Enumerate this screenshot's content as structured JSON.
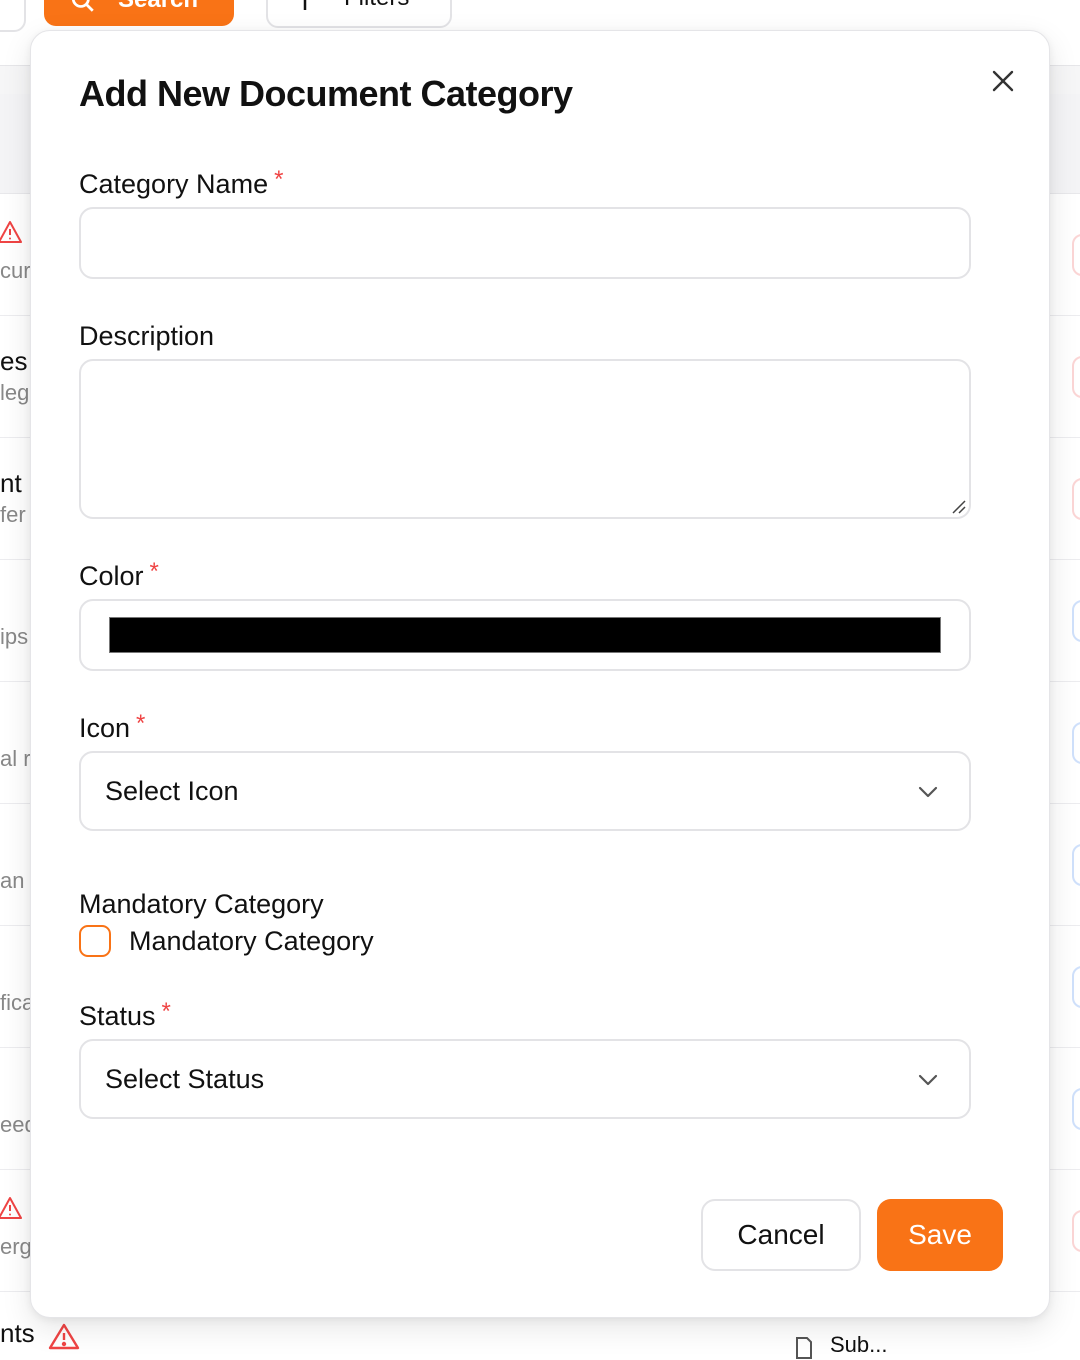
{
  "background": {
    "search_button_label": "Search",
    "filters_button_label": "Filters",
    "rows": [
      {
        "t1": "",
        "t2": "cur",
        "warn": true,
        "pill": "red"
      },
      {
        "t1": "es",
        "t2": "leg",
        "warn": false,
        "pill": "red"
      },
      {
        "t1": "nt",
        "t2": "fer",
        "warn": false,
        "pill": "red"
      },
      {
        "t1": "",
        "t2": "ips",
        "warn": false,
        "pill": "blue"
      },
      {
        "t1": "",
        "t2": "al r",
        "warn": false,
        "pill": "blue"
      },
      {
        "t1": "",
        "t2": "an",
        "warn": false,
        "pill": "blue"
      },
      {
        "t1": "",
        "t2": "fica",
        "warn": false,
        "pill": "blue"
      },
      {
        "t1": "",
        "t2": "eed",
        "warn": false,
        "pill": "blue"
      },
      {
        "t1": "",
        "t2": "erg",
        "warn": true,
        "pill": "red"
      }
    ],
    "bottom_label": "nts",
    "bottom_right_text": "Sub..."
  },
  "modal": {
    "title": "Add New Document Category",
    "close_icon": "close-icon",
    "fields": {
      "category_name": {
        "label": "Category Name",
        "required_mark": "*",
        "value": "",
        "placeholder": ""
      },
      "description": {
        "label": "Description",
        "value": "",
        "placeholder": ""
      },
      "color": {
        "label": "Color",
        "required_mark": "*",
        "value": "#000000"
      },
      "icon": {
        "label": "Icon",
        "required_mark": "*",
        "selected": "Select Icon"
      },
      "mandatory": {
        "label": "Mandatory Category",
        "checkbox_label": "Mandatory Category",
        "checked": false
      },
      "status": {
        "label": "Status",
        "required_mark": "*",
        "selected": "Select Status"
      }
    },
    "buttons": {
      "cancel": "Cancel",
      "save": "Save"
    }
  },
  "colors": {
    "accent": "#f97316",
    "required": "#ef4444",
    "border": "#e3e3e6"
  }
}
